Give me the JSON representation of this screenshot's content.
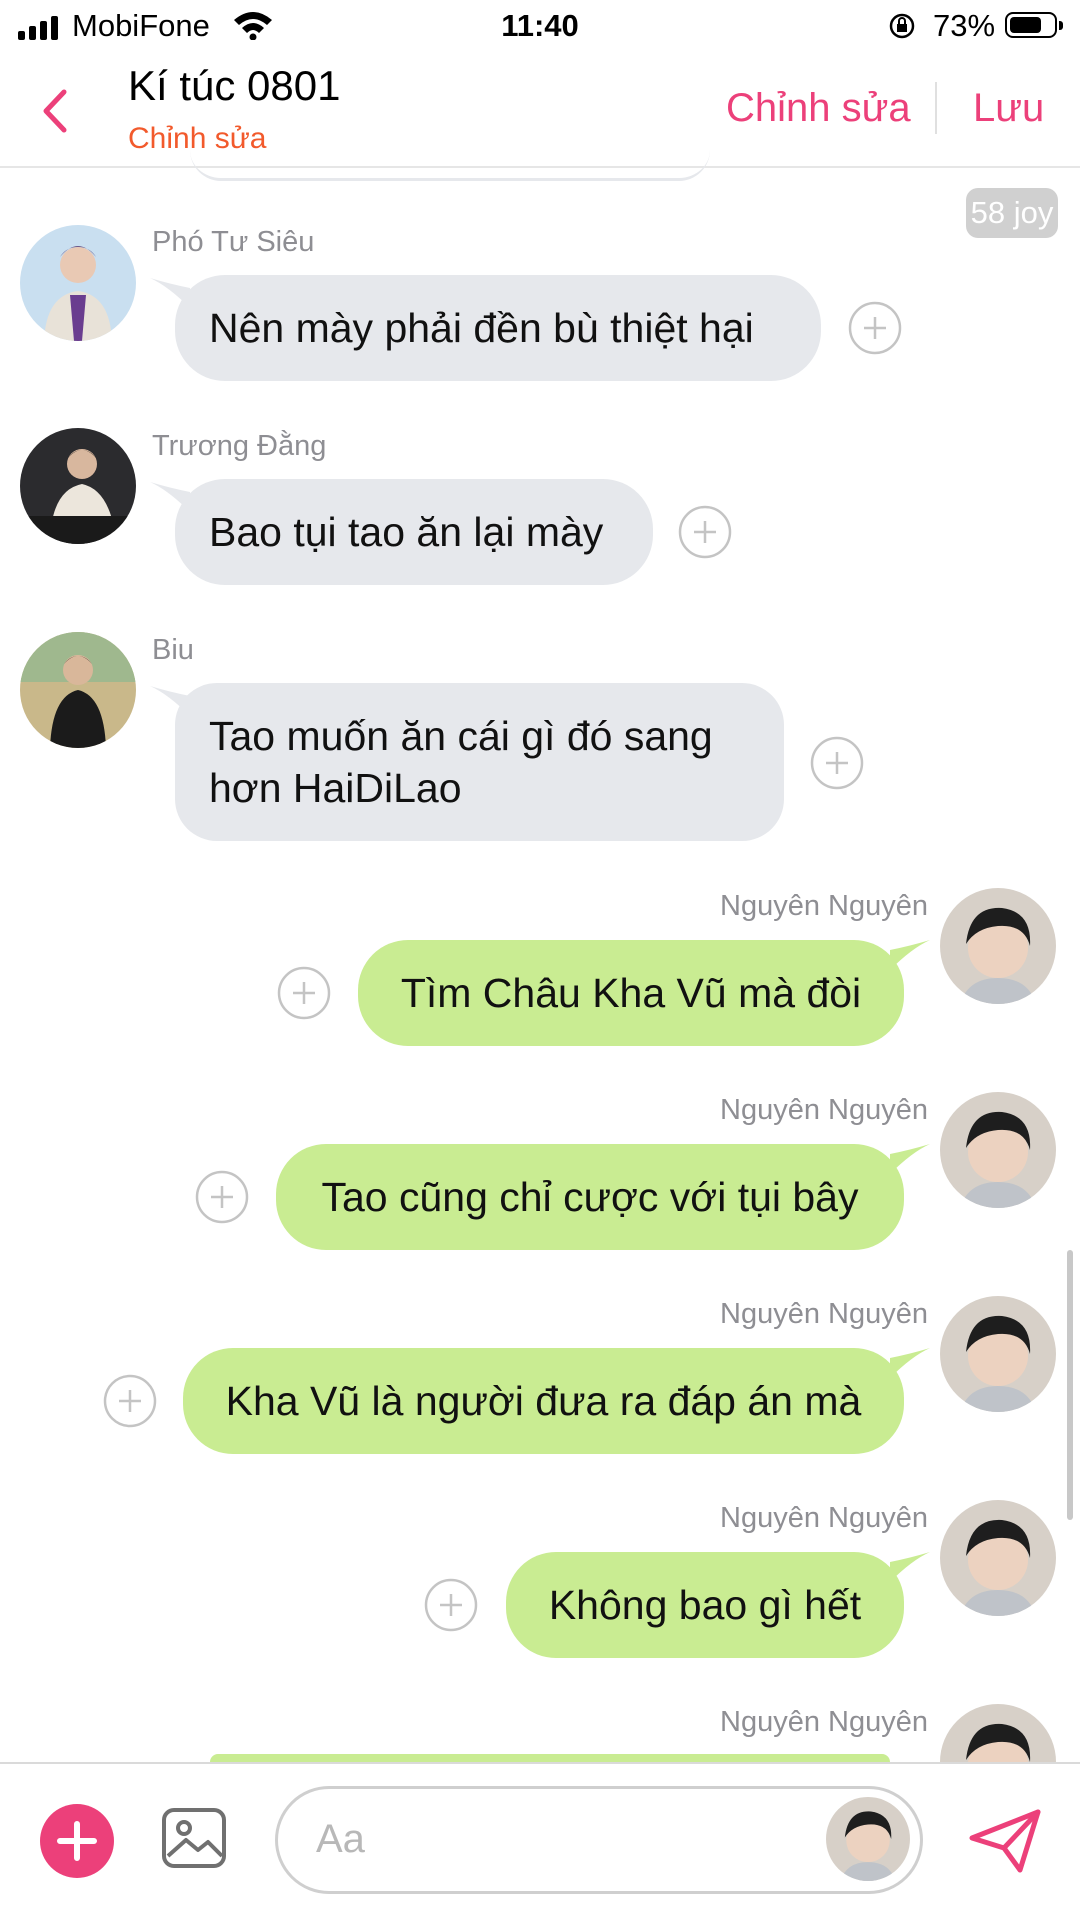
{
  "status_bar": {
    "carrier": "MobiFone",
    "time": "11:40",
    "battery": "73%",
    "battery_level": 0.73
  },
  "header": {
    "title": "Kí túc 0801",
    "subtitle": "Chỉnh sửa",
    "edit_button": "Chỉnh sửa",
    "save_button": "Lưu"
  },
  "chat": {
    "badge": "58 joy",
    "messages": [
      {
        "sender": "Phó Tư Siêu",
        "text": "Nên mày phải đền bù thiệt hại",
        "direction": "incoming"
      },
      {
        "sender": "Trương Đằng",
        "text": "Bao tụi tao ăn lại mày",
        "direction": "incoming"
      },
      {
        "sender": "Biu",
        "text": "Tao muốn ăn cái gì đó sang hơn HaiDiLao",
        "direction": "incoming"
      },
      {
        "sender": "Nguyên Nguyên",
        "text": "Tìm Châu Kha Vũ mà đòi",
        "direction": "outgoing"
      },
      {
        "sender": "Nguyên Nguyên",
        "text": "Tao cũng chỉ cược với tụi bây",
        "direction": "outgoing"
      },
      {
        "sender": "Nguyên Nguyên",
        "text": "Kha Vũ là người đưa ra đáp án mà",
        "direction": "outgoing"
      },
      {
        "sender": "Nguyên Nguyên",
        "text": "Không bao gì hết",
        "direction": "outgoing"
      },
      {
        "sender": "Nguyên Nguyên",
        "text": "",
        "direction": "outgoing"
      }
    ]
  },
  "composer": {
    "placeholder": "Aa"
  },
  "colors": {
    "accent": "#ec407a",
    "subtitle": "#f25a2c",
    "incoming_bubble": "#e6e8ec",
    "outgoing_bubble": "#c9ec92"
  },
  "icons": [
    "signal-icon",
    "wifi-icon",
    "orientation-lock-icon",
    "battery-icon",
    "back-chevron-icon",
    "add-reaction-icon",
    "plus-icon",
    "image-icon",
    "send-icon"
  ]
}
